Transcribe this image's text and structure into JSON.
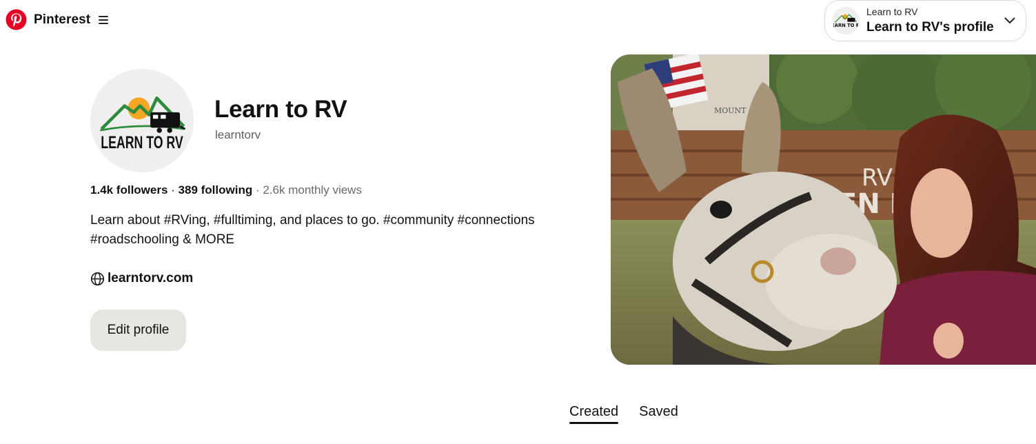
{
  "header": {
    "brand_name": "Pinterest",
    "brand_color": "#E60023",
    "menu_icon": "hamburger-icon"
  },
  "account_switcher": {
    "line1": "Learn to RV",
    "line2": "Learn to RV's profile",
    "icon": "chevron-down-icon"
  },
  "profile": {
    "avatar_text_line1": "LEARN TO RV",
    "name": "Learn to RV",
    "handle": "learntorv",
    "followers": "1.4k followers",
    "separator1": " · ",
    "following": "389 following",
    "separator2": " · ",
    "monthly_views": "2.6k monthly views",
    "bio": "Learn about #RVing, #fulltiming, and places to go. #community #connections #roadschooling & MORE",
    "website": "learntorv.com",
    "website_icon": "globe-icon",
    "edit_label": "Edit profile"
  },
  "cover_photo": {
    "sign_text": "EN RID",
    "sign_text2": "RV PA",
    "mount_text": "MOUNT"
  },
  "tabs": [
    {
      "label": "Created",
      "active": true
    },
    {
      "label": "Saved",
      "active": false
    }
  ]
}
